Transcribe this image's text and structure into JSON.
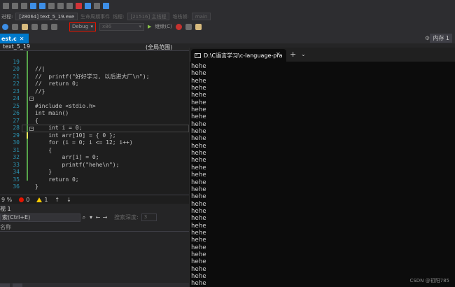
{
  "toolbar": {
    "process_label": "进程:",
    "process_value": "[28064] text_5_19.exe",
    "lifecycle_label": "生命周期事件",
    "thread_label": "线程:",
    "thread_value": "[21516] 主线程",
    "stack_label": "堆栈帧:",
    "stack_value": "main",
    "config_value": "Debug",
    "platform_value": "x86",
    "continue_label": "继续(C)"
  },
  "editor_tabs": {
    "active_tab": "est.c",
    "right_tab": "内存 1"
  },
  "navbar": {
    "project": "text_5_19",
    "scope": "(全局范围)"
  },
  "code_lines": [
    {
      "num": "19",
      "text": "//|"
    },
    {
      "num": "20",
      "text": "//  printf(\"好好学习, 以后进大厂\\n\");"
    },
    {
      "num": "21",
      "text": "//  return 0;"
    },
    {
      "num": "22",
      "text": "//}"
    },
    {
      "num": "23",
      "text": ""
    },
    {
      "num": "24",
      "text": "#include <stdio.h>"
    },
    {
      "num": "25",
      "text": "int main()"
    },
    {
      "num": "26",
      "text": "{"
    },
    {
      "num": "27",
      "text": "    int i = 0;"
    },
    {
      "num": "28",
      "text": "    int arr[10] = { 0 };"
    },
    {
      "num": "29",
      "text": "    for (i = 0; i <= 12; i++)"
    },
    {
      "num": "30",
      "text": "    {"
    },
    {
      "num": "31",
      "text": "        arr[i] = 0;"
    },
    {
      "num": "32",
      "text": "        printf(\"hehe\\n\");"
    },
    {
      "num": "33",
      "text": "    }"
    },
    {
      "num": "34",
      "text": "    return 0;"
    },
    {
      "num": "35",
      "text": "}"
    },
    {
      "num": "36",
      "text": ""
    }
  ],
  "editor_status": {
    "zoom": "9 %",
    "errors": "0",
    "warnings": "1"
  },
  "output_panel": {
    "title": "视 1",
    "search_placeholder": "索(Ctrl+E)",
    "search_depth_label": "搜索深度:",
    "search_depth_value": "3",
    "column_name": "名称"
  },
  "console": {
    "title": "D:\\C语言学习\\c-language-pra",
    "lines": [
      "hehe",
      "hehe",
      "hehe",
      "hehe",
      "hehe",
      "hehe",
      "hehe",
      "hehe",
      "hehe",
      "hehe",
      "hehe",
      "hehe",
      "hehe",
      "hehe",
      "hehe",
      "hehe",
      "hehe",
      "hehe",
      "hehe",
      "hehe",
      "hehe",
      "hehe",
      "hehe",
      "hehe",
      "hehe",
      "hehe",
      "hehe",
      "hehe",
      "hehe",
      "hehe",
      "hehe"
    ],
    "watermark": "CSDN @初阳785"
  }
}
